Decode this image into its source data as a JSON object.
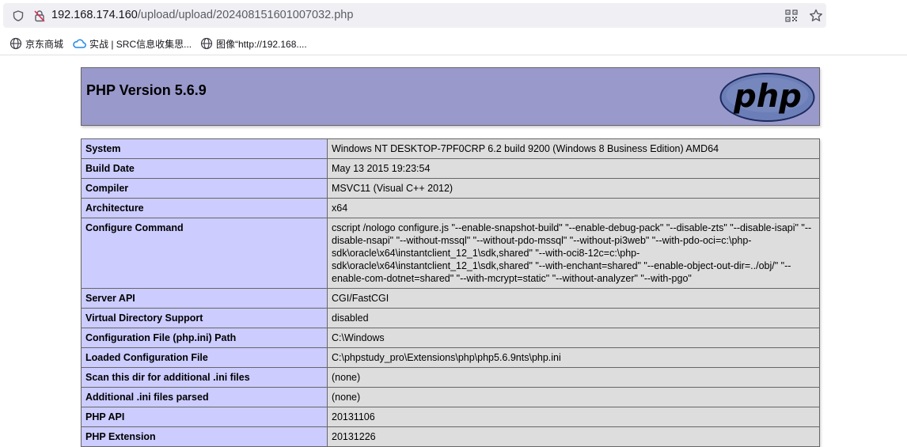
{
  "browser": {
    "url_host": "192.168.174.160",
    "url_path": "/upload/upload/202408151601007032.php",
    "bookmarks": [
      {
        "label": "京东商城",
        "icon": "globe-icon"
      },
      {
        "label": "实战 | SRC信息收集思...",
        "icon": "cloud-icon"
      },
      {
        "label": "图像“http://192.168....",
        "icon": "globe-icon"
      }
    ]
  },
  "phpinfo": {
    "title": "PHP Version 5.6.9",
    "logo_text": "php",
    "rows": [
      {
        "key": "System",
        "value": "Windows NT DESKTOP-7PF0CRP 6.2 build 9200 (Windows 8 Business Edition) AMD64"
      },
      {
        "key": "Build Date",
        "value": "May 13 2015 19:23:54"
      },
      {
        "key": "Compiler",
        "value": "MSVC11 (Visual C++ 2012)"
      },
      {
        "key": "Architecture",
        "value": "x64"
      },
      {
        "key": "Configure Command",
        "value": "cscript /nologo configure.js \"--enable-snapshot-build\" \"--enable-debug-pack\" \"--disable-zts\" \"--disable-isapi\" \"--disable-nsapi\" \"--without-mssql\" \"--without-pdo-mssql\" \"--without-pi3web\" \"--with-pdo-oci=c:\\php-sdk\\oracle\\x64\\instantclient_12_1\\sdk,shared\" \"--with-oci8-12c=c:\\php-sdk\\oracle\\x64\\instantclient_12_1\\sdk,shared\" \"--with-enchant=shared\" \"--enable-object-out-dir=../obj/\" \"--enable-com-dotnet=shared\" \"--with-mcrypt=static\" \"--without-analyzer\" \"--with-pgo\""
      },
      {
        "key": "Server API",
        "value": "CGI/FastCGI"
      },
      {
        "key": "Virtual Directory Support",
        "value": "disabled"
      },
      {
        "key": "Configuration File (php.ini) Path",
        "value": "C:\\Windows"
      },
      {
        "key": "Loaded Configuration File",
        "value": "C:\\phpstudy_pro\\Extensions\\php\\php5.6.9nts\\php.ini"
      },
      {
        "key": "Scan this dir for additional .ini files",
        "value": "(none)"
      },
      {
        "key": "Additional .ini files parsed",
        "value": "(none)"
      },
      {
        "key": "PHP API",
        "value": "20131106"
      },
      {
        "key": "PHP Extension",
        "value": "20131226"
      }
    ]
  },
  "colors": {
    "header_bg": "#9999cc",
    "key_bg": "#ccccff",
    "value_bg": "#dddddd",
    "logo_bg": "#6c7eb7"
  }
}
